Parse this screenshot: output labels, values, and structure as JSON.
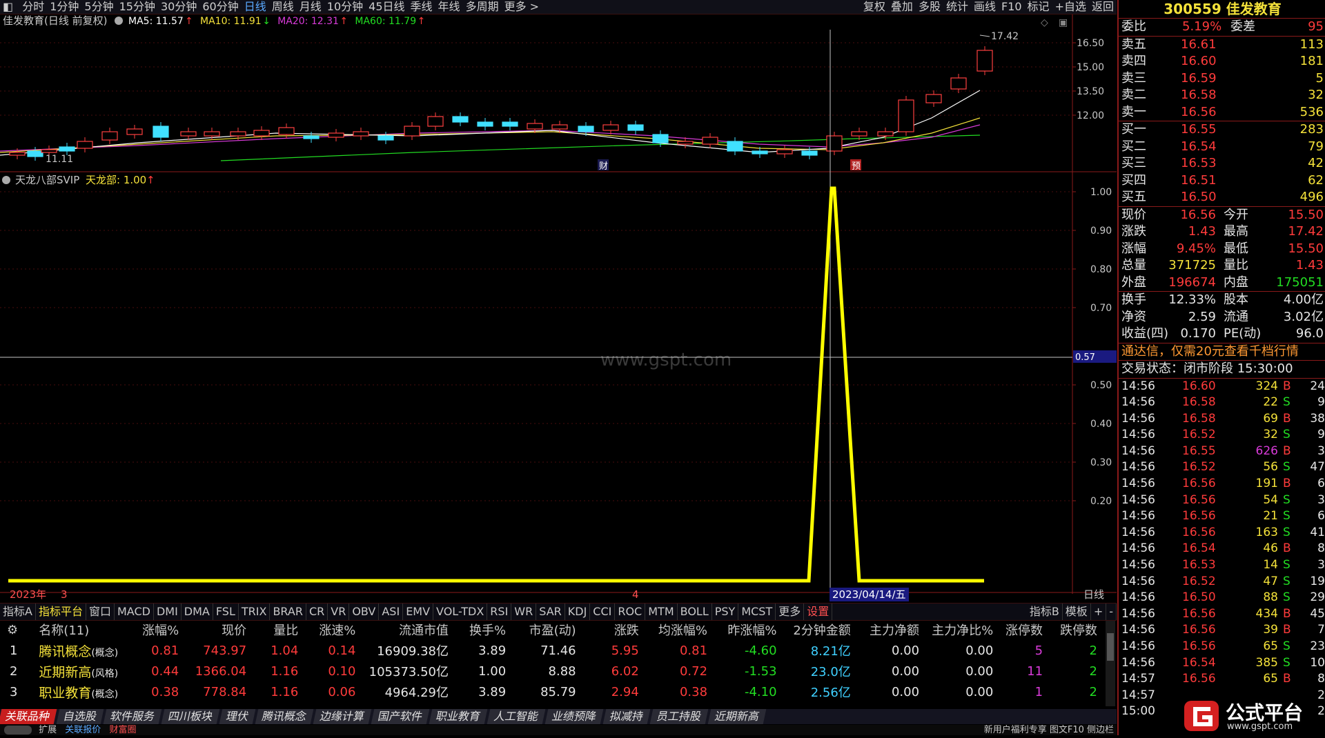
{
  "toolbar": {
    "periods": [
      "分时",
      "1分钟",
      "5分钟",
      "15分钟",
      "30分钟",
      "60分钟",
      "日线",
      "周线",
      "月线",
      "10分钟",
      "45日线",
      "季线",
      "年线",
      "多周期",
      "更多 >"
    ],
    "active_period": "日线",
    "right_tools": [
      "复权",
      "叠加",
      "多股",
      "统计",
      "画线",
      "F10",
      "标记",
      "+自选",
      "返回"
    ]
  },
  "main_chart": {
    "header_label": "佳发教育(日线 前复权)",
    "ma": [
      {
        "label": "MA5: 11.57",
        "color": "#ffffff"
      },
      {
        "label": "MA10: 11.91",
        "color": "#f5e23a"
      },
      {
        "label": "MA20: 12.31",
        "color": "#d93bd9"
      },
      {
        "label": "MA60: 11.79",
        "color": "#22dd22"
      }
    ],
    "ma_arrows": [
      "↑",
      "↓",
      "↑",
      "↑"
    ],
    "price_ticks": [
      "16.50",
      "15.00",
      "13.50",
      "12.00"
    ],
    "high_label": "17.42",
    "low_label": "11.11",
    "markers": [
      "财",
      "预"
    ]
  },
  "indicator_panel": {
    "name": "天龙八部SVIP",
    "value_label": "天龙部: 1.00",
    "y_ticks": [
      "1.00",
      "0.90",
      "0.80",
      "0.70",
      "0.50",
      "0.40",
      "0.30",
      "0.20"
    ],
    "cursor_value": "0.57",
    "watermark": "www.gspt.com"
  },
  "date_axis": {
    "labels": [
      "2023年",
      "3",
      "4"
    ],
    "cursor_date": "2023/04/14/五",
    "period": "日线"
  },
  "indicator_tabs": [
    "指标A",
    "指标平台",
    "窗口",
    "MACD",
    "DMI",
    "DMA",
    "FSL",
    "TRIX",
    "BRAR",
    "CR",
    "VR",
    "OBV",
    "ASI",
    "EMV",
    "VOL-TDX",
    "RSI",
    "WR",
    "SAR",
    "KDJ",
    "CCI",
    "ROC",
    "MTM",
    "BOLL",
    "PSY",
    "MCST",
    "更多",
    "设置"
  ],
  "indicator_tabs_right": [
    "指标B",
    "模板",
    "+",
    "-"
  ],
  "table": {
    "headers": [
      "名称(11)",
      "涨幅%",
      "现价",
      "量比",
      "涨速%",
      "流通市值",
      "换手%",
      "市盈(动)",
      "涨跌",
      "均涨幅%",
      "昨涨幅%",
      "2分钟金额",
      "主力净额",
      "主力净比%",
      "涨停数",
      "跌停数"
    ],
    "rows": [
      {
        "no": "1",
        "name": "腾讯概念",
        "tag": "(概念)",
        "chg": "0.81",
        "price": "743.97",
        "vr": "1.04",
        "speed": "0.14",
        "mcap": "16909.38亿",
        "turn": "3.89",
        "pe": "71.46",
        "diff": "5.95",
        "avgchg": "0.81",
        "ychg": "-4.60",
        "amt2": "8.21亿",
        "net": "0.00",
        "netr": "0.00",
        "up": "5",
        "down": "2"
      },
      {
        "no": "2",
        "name": "近期新高",
        "tag": "(风格)",
        "chg": "0.44",
        "price": "1366.04",
        "vr": "1.16",
        "speed": "0.10",
        "mcap": "105373.50亿",
        "turn": "1.00",
        "pe": "8.88",
        "diff": "6.02",
        "avgchg": "0.72",
        "ychg": "-1.53",
        "amt2": "23.0亿",
        "net": "0.00",
        "netr": "0.00",
        "up": "11",
        "down": "2"
      },
      {
        "no": "3",
        "name": "职业教育",
        "tag": "(概念)",
        "chg": "0.38",
        "price": "778.84",
        "vr": "1.16",
        "speed": "0.06",
        "mcap": "4964.29亿",
        "turn": "3.89",
        "pe": "85.79",
        "diff": "2.94",
        "avgchg": "0.38",
        "ychg": "-4.10",
        "amt2": "2.56亿",
        "net": "0.00",
        "netr": "0.00",
        "up": "1",
        "down": "2"
      }
    ]
  },
  "sectors": [
    "关联品种",
    "自选股",
    "软件服务",
    "四川板块",
    "理伏",
    "腾讯概念",
    "边缘计算",
    "国产软件",
    "职业教育",
    "人工智能",
    "业绩预降",
    "拟减持",
    "员工持股",
    "近期新高"
  ],
  "status": {
    "left": [
      "扩展",
      "关联报价",
      "财富圈"
    ],
    "right": "新用户福利专享 图文F10 侧边栏"
  },
  "quote_panel": {
    "title": "300559 佳发教育",
    "weibi": {
      "label": "委比",
      "value": "5.19%",
      "label2": "委差",
      "value2": "95"
    },
    "sells": [
      {
        "label": "卖五",
        "price": "16.61",
        "vol": "113"
      },
      {
        "label": "卖四",
        "price": "16.60",
        "vol": "181"
      },
      {
        "label": "卖三",
        "price": "16.59",
        "vol": "5"
      },
      {
        "label": "卖二",
        "price": "16.58",
        "vol": "32"
      },
      {
        "label": "卖一",
        "price": "16.56",
        "vol": "536"
      }
    ],
    "buys": [
      {
        "label": "买一",
        "price": "16.55",
        "vol": "283"
      },
      {
        "label": "买二",
        "price": "16.54",
        "vol": "79"
      },
      {
        "label": "买三",
        "price": "16.53",
        "vol": "42"
      },
      {
        "label": "买四",
        "price": "16.51",
        "vol": "62"
      },
      {
        "label": "买五",
        "price": "16.50",
        "vol": "496"
      }
    ],
    "stats": [
      {
        "l1": "现价",
        "v1": "16.56",
        "c1": "red",
        "l2": "今开",
        "v2": "15.50",
        "c2": "red"
      },
      {
        "l1": "涨跌",
        "v1": "1.43",
        "c1": "red",
        "l2": "最高",
        "v2": "17.42",
        "c2": "red"
      },
      {
        "l1": "涨幅",
        "v1": "9.45%",
        "c1": "red",
        "l2": "最低",
        "v2": "15.50",
        "c2": "red"
      },
      {
        "l1": "总量",
        "v1": "371725",
        "c1": "yellow",
        "l2": "量比",
        "v2": "1.43",
        "c2": "red"
      },
      {
        "l1": "外盘",
        "v1": "196674",
        "c1": "red",
        "l2": "内盘",
        "v2": "175051",
        "c2": "green"
      }
    ],
    "stats2": [
      {
        "l1": "换手",
        "v1": "12.33%",
        "l2": "股本",
        "v2": "4.00亿"
      },
      {
        "l1": "净资",
        "v1": "2.59",
        "l2": "流通",
        "v2": "3.02亿"
      },
      {
        "l1": "收益(四)",
        "v1": "0.170",
        "l2": "PE(动)",
        "v2": "96.0"
      }
    ],
    "promo": "通达信，仅需20元查看千档行情",
    "trade_state": "交易状态：闭市阶段 15:30:00",
    "ticks": [
      {
        "t": "14:56",
        "p": "16.60",
        "v": "324",
        "s": "B",
        "n": "24"
      },
      {
        "t": "14:56",
        "p": "16.58",
        "v": "22",
        "s": "S",
        "n": "9"
      },
      {
        "t": "14:56",
        "p": "16.58",
        "v": "69",
        "s": "B",
        "n": "38"
      },
      {
        "t": "14:56",
        "p": "16.52",
        "v": "32",
        "s": "S",
        "n": "9"
      },
      {
        "t": "14:56",
        "p": "16.55",
        "v": "626",
        "s": "B",
        "n": "3"
      },
      {
        "t": "14:56",
        "p": "16.52",
        "v": "56",
        "s": "S",
        "n": "47"
      },
      {
        "t": "14:56",
        "p": "16.56",
        "v": "191",
        "s": "B",
        "n": "6"
      },
      {
        "t": "14:56",
        "p": "16.56",
        "v": "54",
        "s": "S",
        "n": "3"
      },
      {
        "t": "14:56",
        "p": "16.56",
        "v": "21",
        "s": "S",
        "n": "6"
      },
      {
        "t": "14:56",
        "p": "16.56",
        "v": "163",
        "s": "S",
        "n": "41"
      },
      {
        "t": "14:56",
        "p": "16.54",
        "v": "46",
        "s": "B",
        "n": "8"
      },
      {
        "t": "14:56",
        "p": "16.53",
        "v": "14",
        "s": "S",
        "n": "3"
      },
      {
        "t": "14:56",
        "p": "16.52",
        "v": "47",
        "s": "S",
        "n": "19"
      },
      {
        "t": "14:56",
        "p": "16.50",
        "v": "88",
        "s": "S",
        "n": "29"
      },
      {
        "t": "14:56",
        "p": "16.56",
        "v": "434",
        "s": "B",
        "n": "45"
      },
      {
        "t": "14:56",
        "p": "16.56",
        "v": "39",
        "s": "B",
        "n": "7"
      },
      {
        "t": "14:56",
        "p": "16.56",
        "v": "65",
        "s": "S",
        "n": "23"
      },
      {
        "t": "14:56",
        "p": "16.54",
        "v": "385",
        "s": "S",
        "n": "10"
      },
      {
        "t": "14:57",
        "p": "16.56",
        "v": "65",
        "s": "B",
        "n": "8"
      },
      {
        "t": "14:57",
        "p": "",
        "v": "",
        "s": "",
        "n": "2"
      },
      {
        "t": "15:00",
        "p": "",
        "v": "",
        "s": "",
        "n": "2"
      }
    ]
  },
  "logo": {
    "text": "公式平台",
    "url": "www.gspt.com"
  }
}
